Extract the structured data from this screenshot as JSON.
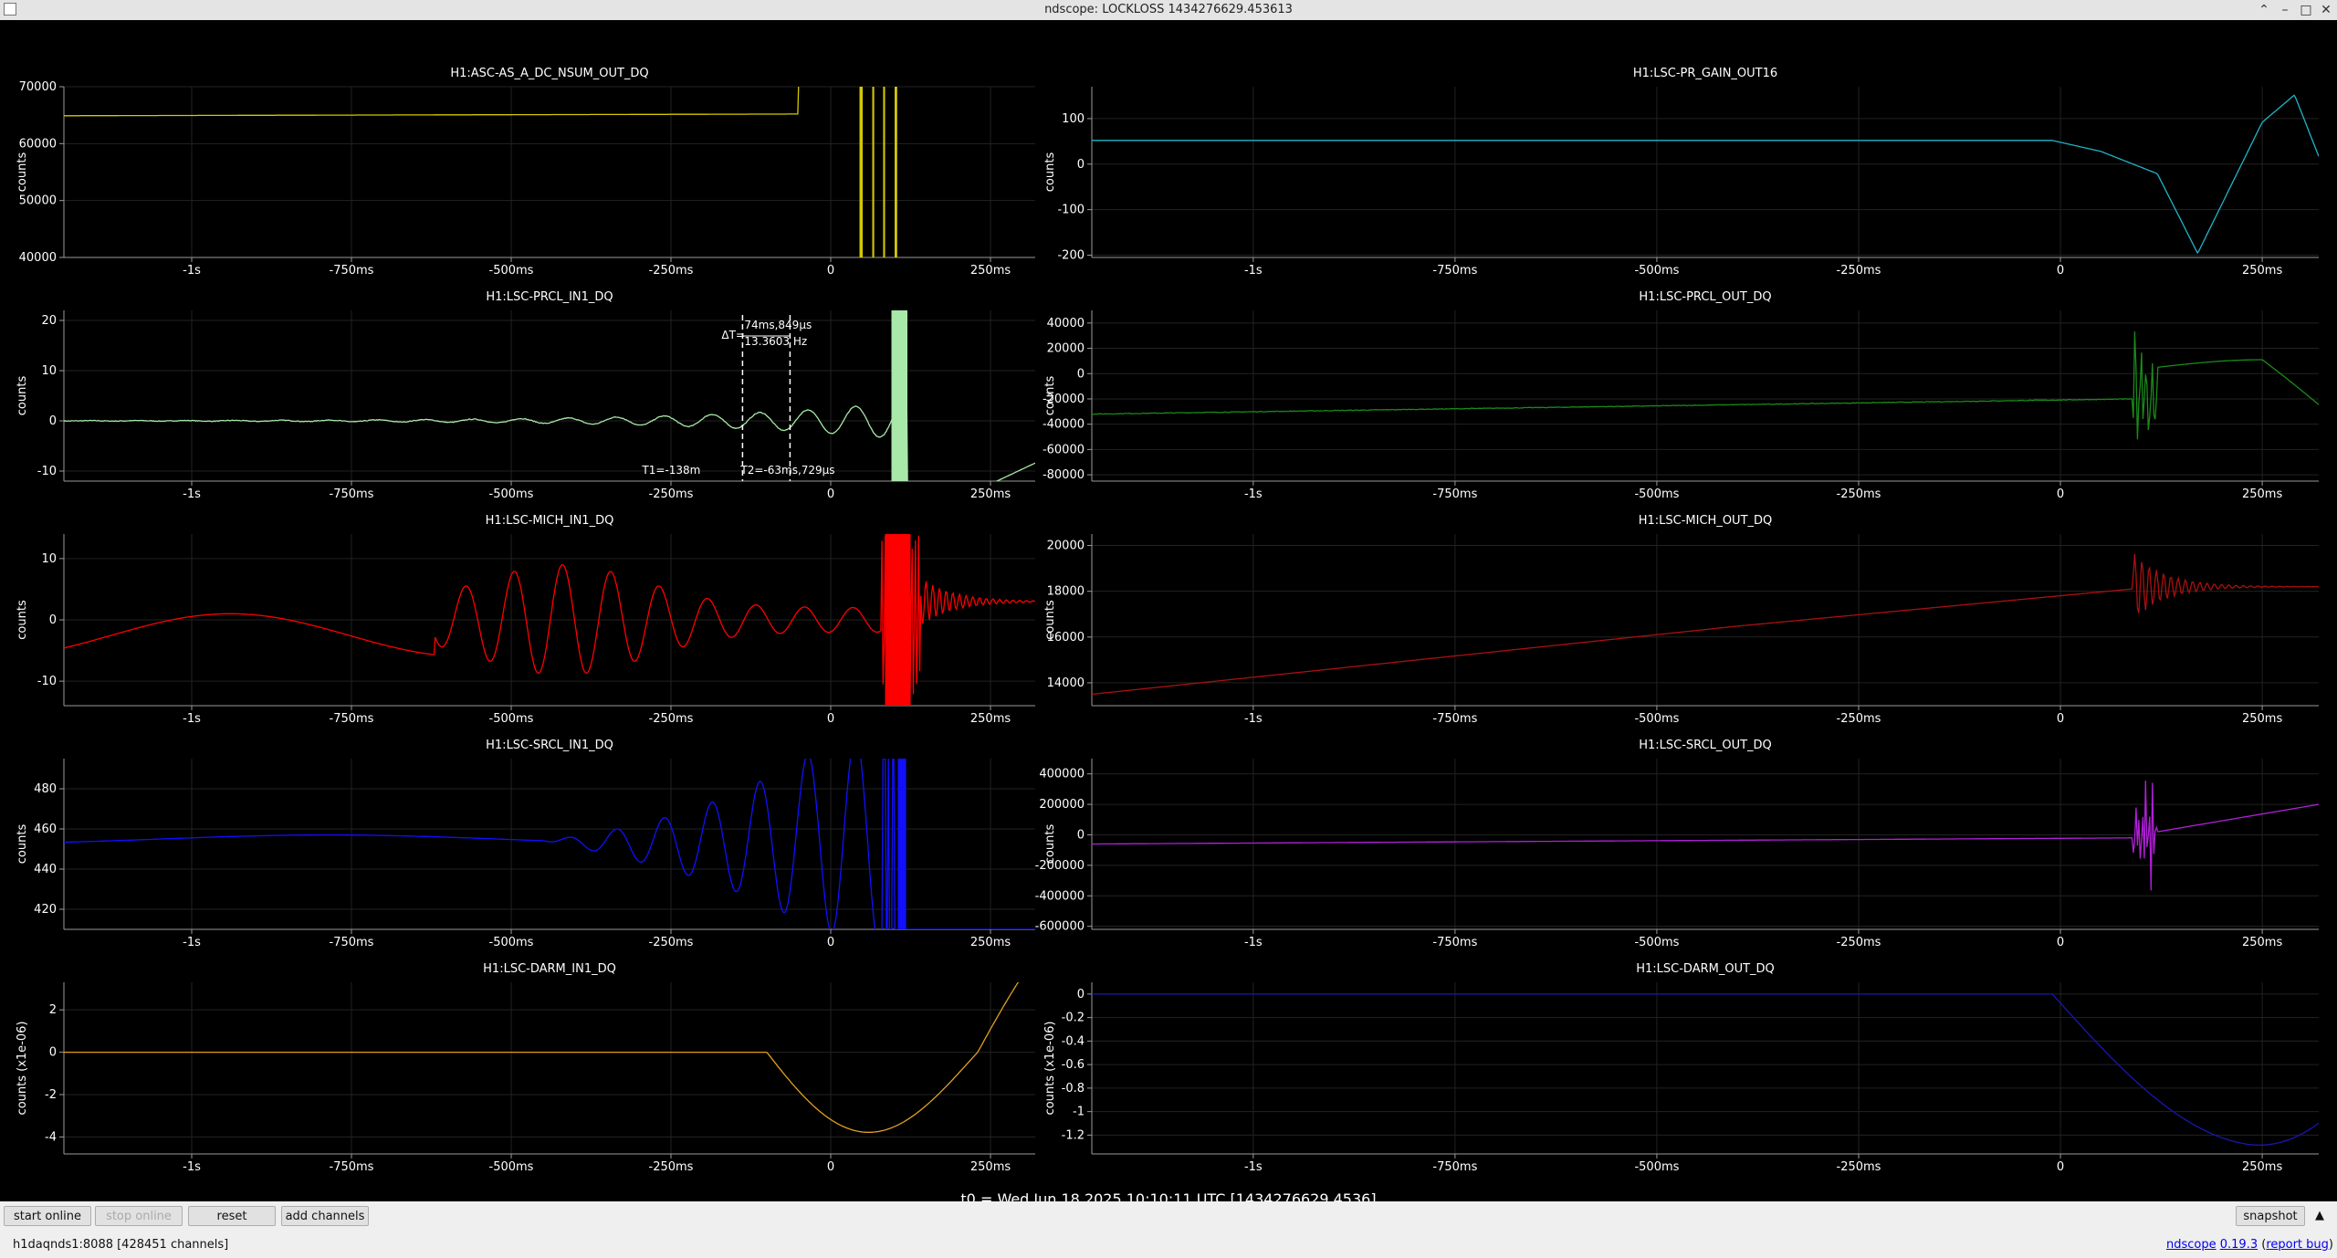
{
  "window": {
    "title": "ndscope: LOCKLOSS 1434276629.453613"
  },
  "toolbar": {
    "start_online": "start online",
    "stop_online": "stop online",
    "reset": "reset",
    "add_channels": "add channels",
    "snapshot": "snapshot"
  },
  "status": {
    "server": "h1daqnds1:8088  [428451 channels]",
    "app_name": "ndscope",
    "version": "0.19.3",
    "report_bug": "report bug"
  },
  "t0_label": "t0 = Wed Jun 18 2025 10:10:11 UTC [1434276629.4536]",
  "cursor": {
    "delta_prefix": "ΔT=",
    "delta_time": "74ms,849μs",
    "frequency": "13.3603 Hz",
    "t1": "T1=-138m",
    "t2": "T2=-63ms,729μs"
  },
  "colors": {
    "background": "#000000",
    "axis": "#9a9a9a",
    "grid": "#222222"
  },
  "chart_data": [
    {
      "type": "line",
      "title": "H1:ASC-AS_A_DC_NSUM_OUT_DQ",
      "ylabel": "counts",
      "color": "#d4c800",
      "xticks": [
        "-1s",
        "-750ms",
        "-500ms",
        "-250ms",
        "0",
        "250ms"
      ],
      "yticks": [
        "70000",
        "60000",
        "50000",
        "40000"
      ],
      "xlim": [
        -1.2,
        0.32
      ],
      "ylim": [
        40000,
        70000
      ]
    },
    {
      "type": "line",
      "title": "H1:LSC-PR_GAIN_OUT16",
      "ylabel": "counts",
      "color": "#20b4c8",
      "xticks": [
        "-1s",
        "-750ms",
        "-500ms",
        "-250ms",
        "0",
        "250ms"
      ],
      "yticks": [
        "100",
        "0",
        "-100",
        "-200"
      ],
      "xlim": [
        -1.2,
        0.32
      ],
      "ylim": [
        -205,
        170
      ]
    },
    {
      "type": "line",
      "title": "H1:LSC-PRCL_IN1_DQ",
      "ylabel": "counts",
      "color": "#a8e8a8",
      "xticks": [
        "-1s",
        "-750ms",
        "-500ms",
        "-250ms",
        "0",
        "250ms"
      ],
      "yticks": [
        "20",
        "10",
        "0",
        "-10"
      ],
      "xlim": [
        -1.2,
        0.32
      ],
      "ylim": [
        -12,
        22
      ]
    },
    {
      "type": "line",
      "title": "H1:LSC-PRCL_OUT_DQ",
      "ylabel": "counts",
      "color": "#1a8a1a",
      "xticks": [
        "-1s",
        "-750ms",
        "-500ms",
        "-250ms",
        "0",
        "250ms"
      ],
      "yticks": [
        "40000",
        "20000",
        "0",
        "-20000",
        "-40000",
        "-60000",
        "-80000"
      ],
      "xlim": [
        -1.2,
        0.32
      ],
      "ylim": [
        -85000,
        50000
      ]
    },
    {
      "type": "line",
      "title": "H1:LSC-MICH_IN1_DQ",
      "ylabel": "counts",
      "color": "#ff0000",
      "xticks": [
        "-1s",
        "-750ms",
        "-500ms",
        "-250ms",
        "0",
        "250ms"
      ],
      "yticks": [
        "10",
        "0",
        "-10"
      ],
      "xlim": [
        -1.2,
        0.32
      ],
      "ylim": [
        -14,
        14
      ]
    },
    {
      "type": "line",
      "title": "H1:LSC-MICH_OUT_DQ",
      "ylabel": "counts",
      "color": "#aa1010",
      "xticks": [
        "-1s",
        "-750ms",
        "-500ms",
        "-250ms",
        "0",
        "250ms"
      ],
      "yticks": [
        "20000",
        "18000",
        "16000",
        "14000"
      ],
      "xlim": [
        -1.2,
        0.32
      ],
      "ylim": [
        13000,
        20500
      ]
    },
    {
      "type": "line",
      "title": "H1:LSC-SRCL_IN1_DQ",
      "ylabel": "counts",
      "color": "#1010ff",
      "xticks": [
        "-1s",
        "-750ms",
        "-500ms",
        "-250ms",
        "0",
        "250ms"
      ],
      "yticks": [
        "480",
        "460",
        "440",
        "420"
      ],
      "xlim": [
        -1.2,
        0.32
      ],
      "ylim": [
        410,
        495
      ]
    },
    {
      "type": "line",
      "title": "H1:LSC-SRCL_OUT_DQ",
      "ylabel": "counts",
      "color": "#b020d8",
      "xticks": [
        "-1s",
        "-750ms",
        "-500ms",
        "-250ms",
        "0",
        "250ms"
      ],
      "yticks": [
        "400000",
        "200000",
        "0",
        "-200000",
        "-400000",
        "-600000"
      ],
      "xlim": [
        -1.2,
        0.32
      ],
      "ylim": [
        -620000,
        500000
      ]
    },
    {
      "type": "line",
      "title": "H1:LSC-DARM_IN1_DQ",
      "ylabel": "counts (x1e-06)",
      "color": "#e0a020",
      "xticks": [
        "-1s",
        "-750ms",
        "-500ms",
        "-250ms",
        "0",
        "250ms"
      ],
      "yticks": [
        "2",
        "0",
        "-2",
        "-4"
      ],
      "xlim": [
        -1.2,
        0.32
      ],
      "ylim": [
        -4.8,
        3.3
      ]
    },
    {
      "type": "line",
      "title": "H1:LSC-DARM_OUT_DQ",
      "ylabel": "counts (x1e-06)",
      "color": "#1818b0",
      "xticks": [
        "-1s",
        "-750ms",
        "-500ms",
        "-250ms",
        "0",
        "250ms"
      ],
      "yticks": [
        "0",
        "-0.2",
        "-0.4",
        "-0.6",
        "-0.8",
        "-1",
        "-1.2"
      ],
      "xlim": [
        -1.2,
        0.32
      ],
      "ylim": [
        -1.36,
        0.1
      ]
    }
  ]
}
